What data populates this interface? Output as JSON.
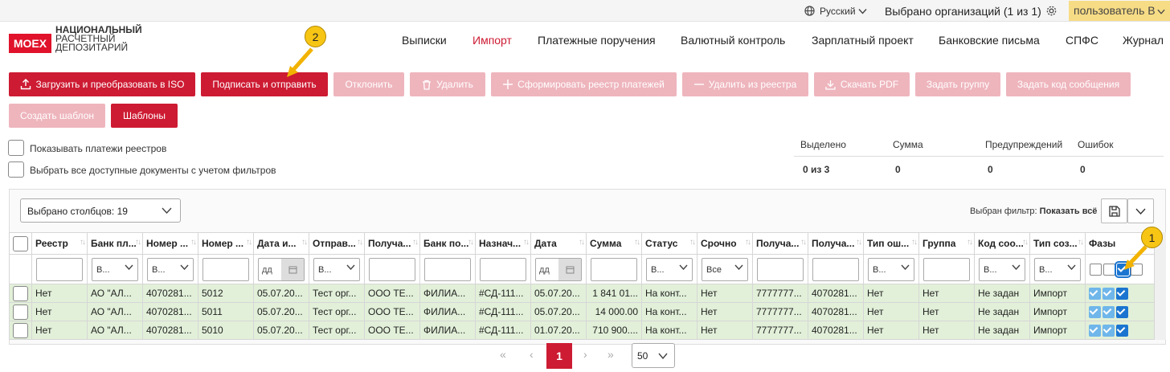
{
  "topbar": {
    "language": "Русский",
    "organizations": "Выбрано организаций (1 из 1)",
    "user": "пользователь В"
  },
  "logo": {
    "badge": "MOEX",
    "line1": "НАЦИОНАЛЬНЫЙ",
    "line2": "РАСЧЕТНЫЙ",
    "line3": "ДЕПОЗИТАРИЙ"
  },
  "nav": [
    "Выписки",
    "Импорт",
    "Платежные поручения",
    "Валютный контроль",
    "Зарплатный проект",
    "Банковские письма",
    "СПФС",
    "Журнал"
  ],
  "toolbar": {
    "upload": "Загрузить и преобразовать в ISO",
    "sign_send": "Подписать и отправить",
    "reject": "Отклонить",
    "delete": "Удалить",
    "form_registry": "Сформировать реестр платежей",
    "remove_registry": "Удалить из реестра",
    "download_pdf": "Скачать PDF",
    "set_group": "Задать группу",
    "set_message_code": "Задать код сообщения",
    "create_template": "Создать шаблон",
    "templates": "Шаблоны"
  },
  "options": {
    "show_registry": "Показывать платежи реестров",
    "select_all": "Выбрать все доступные документы с учетом фильтров"
  },
  "stats": {
    "selected_label": "Выделено",
    "sum_label": "Сумма",
    "warnings_label": "Предупреждений",
    "errors_label": "Ошибок",
    "selected_value": "0 из 3",
    "sum_value": "0",
    "warnings_value": "0",
    "errors_value": "0"
  },
  "table": {
    "columns_selected": "Выбрано столбцов: 19",
    "filter_label": "Выбран фильтр:",
    "filter_value": "Показать всё",
    "headers": [
      "Реестр",
      "Банк пл...",
      "Номер ...",
      "Номер ...",
      "Дата и...",
      "Отправ...",
      "Получа...",
      "Банк по...",
      "Назнач...",
      "Дата",
      "Сумма",
      "Статус",
      "Срочно",
      "Получа...",
      "Получа...",
      "Тип ош...",
      "Группа",
      "Код соо...",
      "Тип соз...",
      "Фазы"
    ],
    "filter_placeholders": {
      "select": "В...",
      "all": "Все",
      "date": "дд"
    },
    "rows": [
      [
        "Нет",
        "АО \"АЛ...",
        "4070281...",
        "5012",
        "05.07.20...",
        "Тест орг...",
        "ООО ТЕ...",
        "ФИЛИА...",
        "#СД-111...",
        "05.07.20...",
        "1 841 01...",
        "На конт...",
        "Нет",
        "7777777...",
        "4070281...",
        "Нет",
        "Нет",
        "Не задан",
        "Импорт"
      ],
      [
        "Нет",
        "АО \"АЛ...",
        "4070281...",
        "5011",
        "05.07.20...",
        "Тест орг...",
        "ООО ТЕ...",
        "ФИЛИА...",
        "#СД-111...",
        "05.07.20...",
        "14 000.00",
        "На конт...",
        "Нет",
        "7777777...",
        "4070281...",
        "Нет",
        "Нет",
        "Не задан",
        "Импорт"
      ],
      [
        "Нет",
        "АО \"АЛ...",
        "4070281...",
        "5010",
        "05.07.20...",
        "Тест орг...",
        "ООО ТЕ...",
        "ФИЛИА...",
        "#СД-111...",
        "01.07.20...",
        "710 900....",
        "На конт...",
        "Нет",
        "7777777...",
        "4070281...",
        "Нет",
        "Нет",
        "Не задан",
        "Импорт"
      ]
    ]
  },
  "pagination": {
    "current": "1",
    "page_size": "50"
  },
  "callouts": {
    "one": "1",
    "two": "2"
  },
  "colors": {
    "brand": "#cd1b33",
    "disabled": "#eeb5bd",
    "row": "#e2f0d9",
    "callout": "#f7c514"
  }
}
